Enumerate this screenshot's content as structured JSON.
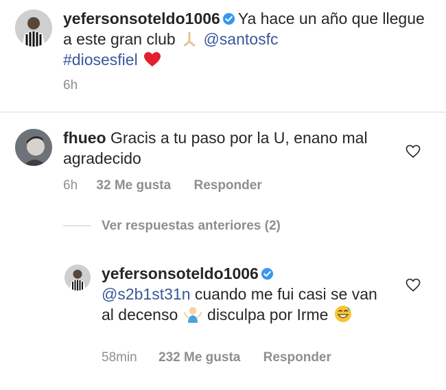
{
  "caption": {
    "username": "yefersonsoteldo1006",
    "text_part1": "Ya hace un año que llegue a este gran club",
    "mention": "@santosfc",
    "hashtag": "#diosesfiel",
    "time": "6h",
    "icons": [
      "verified-badge-icon",
      "praying-hands-emoji",
      "red-heart-emoji"
    ]
  },
  "comment": {
    "username": "fhueo",
    "text": "Gracis a tu paso por la U, enano mal agradecido",
    "time": "6h",
    "likes": "32 Me gusta",
    "reply_label": "Responder",
    "icons": [
      "like-heart-icon"
    ]
  },
  "view_previous_replies": "Ver respuestas anteriores (2)",
  "reply": {
    "username": "yefersonsoteldo1006",
    "mention": "@s2b1st31n",
    "text_part1": "cuando me fui casi se van al decenso",
    "text_part2": "disculpa por Irme",
    "time": "58min",
    "likes": "232 Me gusta",
    "reply_label": "Responder",
    "icons": [
      "verified-badge-icon",
      "person-shrugging-emoji",
      "grinning-sweat-emoji",
      "like-heart-icon"
    ]
  },
  "colors": {
    "text": "#262626",
    "muted": "#8e8e8e",
    "link": "#385898",
    "verified": "#3897f0",
    "divider": "#dbdbdb"
  }
}
